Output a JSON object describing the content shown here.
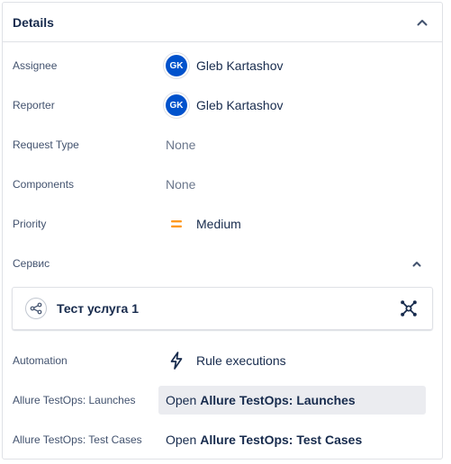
{
  "details": {
    "title": "Details",
    "fields": {
      "assignee": {
        "label": "Assignee",
        "initials": "GK",
        "name": "Gleb Kartashov"
      },
      "reporter": {
        "label": "Reporter",
        "initials": "GK",
        "name": "Gleb Kartashov"
      },
      "request_type": {
        "label": "Request Type",
        "value": "None"
      },
      "components": {
        "label": "Components",
        "value": "None"
      },
      "priority": {
        "label": "Priority",
        "value": "Medium",
        "icon": "priority-medium-icon",
        "color": "#ff991f"
      },
      "service": {
        "label": "Сервис",
        "card_name": "Тест услуга 1"
      },
      "automation": {
        "label": "Automation",
        "value": "Rule executions",
        "icon": "lightning-bolt-icon"
      },
      "launches": {
        "label": "Allure TestOps: Launches",
        "prefix": "Open",
        "link": "Allure TestOps: Launches"
      },
      "test_cases": {
        "label": "Allure TestOps: Test Cases",
        "prefix": "Open",
        "link": "Allure TestOps: Test Cases"
      }
    }
  },
  "colors": {
    "avatar_bg": "#0052cc",
    "text": "#172b4d",
    "label": "#42526e",
    "muted": "#6b778c",
    "hover_bg": "#ebecf0"
  }
}
